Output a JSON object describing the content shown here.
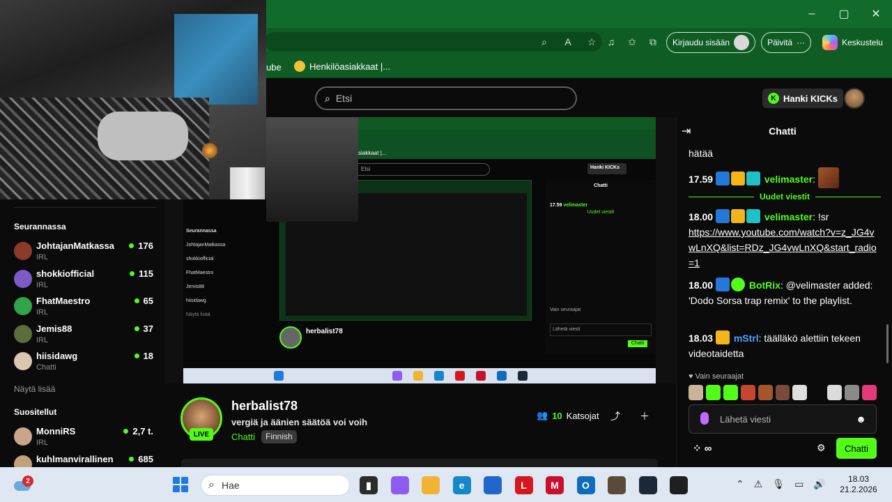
{
  "browser": {
    "window_controls": {
      "minimize": "–",
      "maximize": "▢",
      "close": "✕"
    },
    "signin_label": "Kirjaudu sisään",
    "update_label": "Päivitä",
    "update_more": "···",
    "copilot_label": "Keskustelu",
    "bookmarks": [
      {
        "label": "ube"
      },
      {
        "label": "Henkilöasiakkaat |..."
      }
    ]
  },
  "header": {
    "search_placeholder": "Etsi",
    "kicks_label": "Hanki KICKs"
  },
  "sidebar": {
    "following_title": "Seurannassa",
    "following": [
      {
        "name": "JohtajanMatkassa",
        "category": "IRL",
        "viewers": "176",
        "color": "#8a3b2b"
      },
      {
        "name": "shokkiofficial",
        "category": "IRL",
        "viewers": "115",
        "color": "#7c5ac7"
      },
      {
        "name": "FhatMaestro",
        "category": "IRL",
        "viewers": "65",
        "color": "#2fa44a"
      },
      {
        "name": "Jemis88",
        "category": "IRL",
        "viewers": "37",
        "color": "#5a6e3b"
      },
      {
        "name": "hiisidawg",
        "category": "Chatti",
        "viewers": "18",
        "color": "#d9c7b0"
      }
    ],
    "show_more": "Näytä lisää",
    "recommended_title": "Suositellut",
    "recommended": [
      {
        "name": "MonniRS",
        "category": "IRL",
        "viewers": "2,7 t.",
        "color": "#c9a58b"
      },
      {
        "name": "kuhlmanvirallinen",
        "category": "",
        "viewers": "685",
        "color": "#c2a27a"
      }
    ]
  },
  "stream": {
    "streamer": "herbalist78",
    "title": "vergiä ja äänien säätöä voi voih",
    "category": "Chatti",
    "tag": "Finnish",
    "live_label": "LIVE",
    "viewers": "10",
    "viewers_label": "Katsojat"
  },
  "chat": {
    "title": "Chatti",
    "messages": [
      {
        "time": "",
        "user": "",
        "text": "hätää"
      },
      {
        "time": "17.59",
        "user": "velimaster",
        "text": ":"
      },
      {
        "time": "18.00",
        "user": "velimaster",
        "text": ": !sr",
        "link": "https://www.youtube.com/watch?v=z_JG4vwLnXQ&list=RDz_JG4vwLnXQ&start_radio=1"
      },
      {
        "time": "18.00",
        "user": "BotRix",
        "text": ": @velimaster added: 'Dodo Sorsa trap remix' to the playlist."
      },
      {
        "time": "18.03",
        "user": "mStrl",
        "text": ": täälläkö alettiin tekeen videotaidetta"
      }
    ],
    "new_messages": "Uudet viestit",
    "followers_only": "Vain seuraajat",
    "input_placeholder": "Lähetä viesti",
    "ext_label": "∞",
    "send_label": "Chatti"
  },
  "video_capture": {
    "search_placeholder": "Etsi",
    "kicks_label": "Hanki KICKs",
    "chat_title": "Chatti",
    "streamer": "herbalist78",
    "bookmark": "Henkilöasiakkaat |...",
    "side_title": "Seurannassa",
    "side_items": [
      "JohtajanMatkassa",
      "shokkiofficial",
      "FhatMaestro",
      "Jemis88",
      "hiisidawg"
    ],
    "side_more": "Näytä lisää",
    "chat_new": "Uudet viestit",
    "chat_time": "17.59",
    "chat_user": "velimaster",
    "chat_followers": "Vain seuraajat",
    "chat_input": "Lähetä viesti",
    "chat_send": "Chatti"
  },
  "taskbar": {
    "notification_count": "2",
    "search_placeholder": "Hae",
    "clock_time": "18.03",
    "clock_date": "21.2.2026",
    "apps": [
      {
        "name": "task-view-icon",
        "glyph": "▮",
        "color": "#2b2b2b"
      },
      {
        "name": "copilot-app-icon",
        "glyph": "",
        "color": "#8f5cf0"
      },
      {
        "name": "file-explorer-icon",
        "glyph": "",
        "color": "#f2b233"
      },
      {
        "name": "edge-icon",
        "glyph": "e",
        "color": "#1588c9"
      },
      {
        "name": "store-icon",
        "glyph": "",
        "color": "#2167c9"
      },
      {
        "name": "l-app-icon",
        "glyph": "L",
        "color": "#d5181f"
      },
      {
        "name": "mcafee-icon",
        "glyph": "M",
        "color": "#c8102e"
      },
      {
        "name": "outlook-new-icon",
        "glyph": "O",
        "color": "#0f6cbd"
      },
      {
        "name": "game-app-icon",
        "glyph": "",
        "color": "#5b4a3a"
      },
      {
        "name": "steam-icon",
        "glyph": "",
        "color": "#1b2838"
      },
      {
        "name": "obs-icon",
        "glyph": "",
        "color": "#1f1f1f"
      }
    ]
  },
  "colors": {
    "kick_green": "#53fc18",
    "edge_green": "#116b2b"
  }
}
